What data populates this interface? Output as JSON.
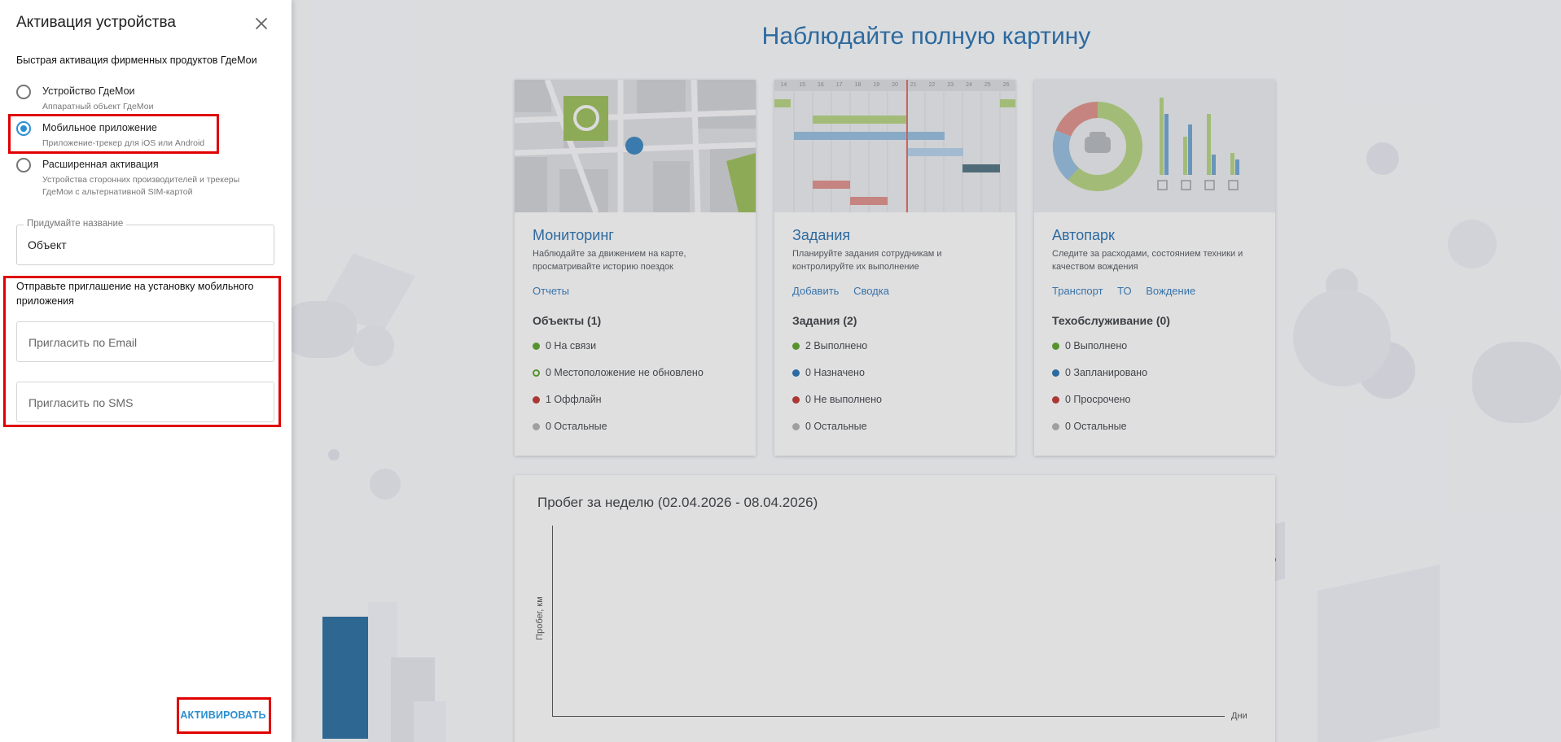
{
  "panel": {
    "title": "Активация устройства",
    "subtitle": "Быстрая активация фирменных продуктов ГдеМои",
    "options": [
      {
        "label": "Устройство ГдеМои",
        "hint": [
          "Аппаратный объект ГдеМои"
        ],
        "checked": false
      },
      {
        "label": "Мобильное приложение",
        "hint": [
          "Приложение-трекер для iOS или Android"
        ],
        "checked": true
      },
      {
        "label": "Расширенная активация",
        "hint": [
          "Устройства сторонних производителей и трекеры",
          "ГдеМои с альтернативной SIM-картой"
        ],
        "checked": false
      }
    ],
    "name_field": {
      "legend": "Придумайте название",
      "value": "Объект"
    },
    "invite": {
      "title": "Отправьте приглашение на установку мобильного приложения",
      "email_placeholder": "Пригласить по Email",
      "sms_placeholder": "Пригласить по SMS"
    },
    "activate_label": "АКТИВИРОВАТЬ"
  },
  "background": {
    "title": "Наблюдайте полную картину",
    "cards": [
      {
        "title": "Мониторинг",
        "desc": "Наблюдайте за движением на карте, просматривайте историю поездок",
        "links": [
          "Отчеты"
        ],
        "count_label": "Объекты (1)",
        "stats": [
          {
            "text": "0 На связи",
            "color": "#5a9a2f",
            "hollow": false
          },
          {
            "text": "0 Местоположение не обновлено",
            "color": "#5a9a2f",
            "hollow": true
          },
          {
            "text": "1 Оффлайн",
            "color": "#b23a36",
            "hollow": false
          },
          {
            "text": "0 Остальные",
            "color": "#a6a6a6",
            "hollow": false
          }
        ]
      },
      {
        "title": "Задания",
        "desc": "Планируйте задания сотрудникам и контролируйте их выполнение",
        "links": [
          "Добавить",
          "Сводка"
        ],
        "count_label": "Задания (2)",
        "stats": [
          {
            "text": "2 Выполнено",
            "color": "#5a9a2f",
            "hollow": false
          },
          {
            "text": "0 Назначено",
            "color": "#2f6fa6",
            "hollow": false
          },
          {
            "text": "0 Не выполнено",
            "color": "#b23a36",
            "hollow": false
          },
          {
            "text": "0 Остальные",
            "color": "#a6a6a6",
            "hollow": false
          }
        ]
      },
      {
        "title": "Автопарк",
        "desc": "Следите за расходами, состоянием техники и качеством вождения",
        "links": [
          "Транспорт",
          "ТО",
          "Вождение"
        ],
        "count_label": "Техобслуживание (0)",
        "stats": [
          {
            "text": "0 Выполнено",
            "color": "#5a9a2f",
            "hollow": false
          },
          {
            "text": "0 Запланировано",
            "color": "#2f6fa6",
            "hollow": false
          },
          {
            "text": "0 Просрочено",
            "color": "#b23a36",
            "hollow": false
          },
          {
            "text": "0 Остальные",
            "color": "#a6a6a6",
            "hollow": false
          }
        ]
      }
    ],
    "mileage": {
      "title": "Пробег за неделю (02.04.2026 - 08.04.2026)",
      "ylabel": "Пробег, км",
      "xlabel": "Дни"
    },
    "gantt_days": [
      "14",
      "15",
      "16",
      "17",
      "18",
      "19",
      "20",
      "21",
      "22",
      "23",
      "24",
      "25",
      "26"
    ]
  },
  "colors": {
    "accent": "#2b8fd1",
    "title_blue": "#2f6fa6",
    "highlight": "#e00000"
  }
}
